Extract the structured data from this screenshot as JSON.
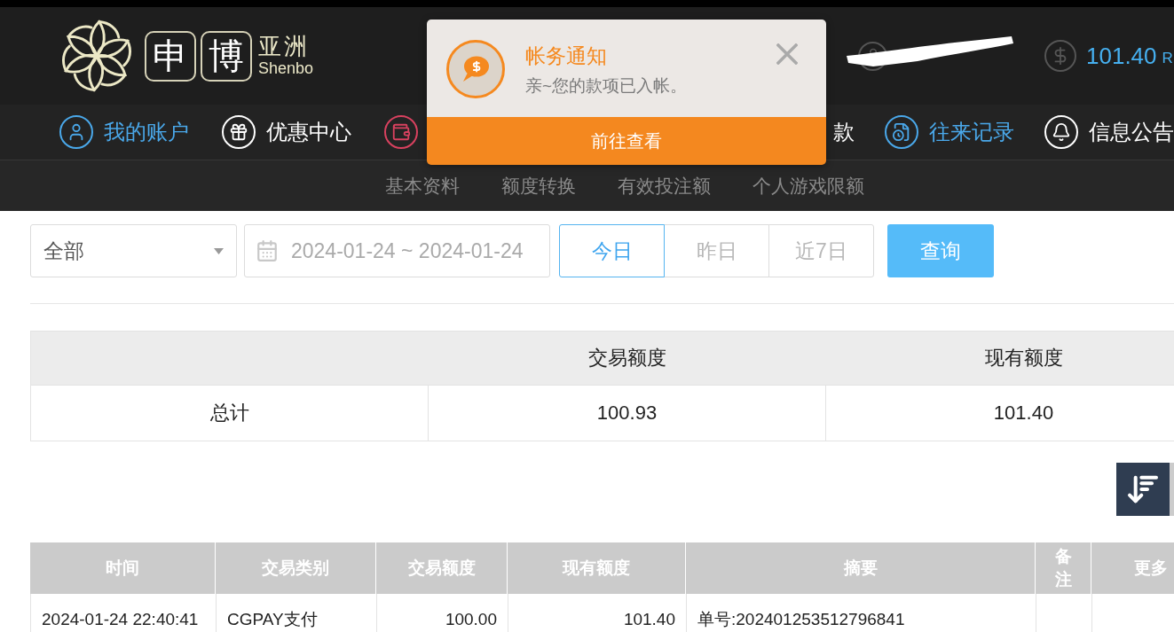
{
  "header": {
    "logo": {
      "characters": [
        "申",
        "博"
      ],
      "name": "亚洲",
      "latin_name": "Shenbo"
    },
    "balance": {
      "amount": "101.40",
      "currency": "R"
    }
  },
  "notification": {
    "title": "帐务通知",
    "message": "亲~您的款项已入帐。",
    "action": "前往查看"
  },
  "nav": {
    "left_items": [
      {
        "kind": "icon_text",
        "label": "我的账户",
        "color": "#4aa8ea"
      },
      {
        "kind": "icon_text",
        "label": "优惠中心",
        "color": "#ffffff"
      },
      {
        "kind": "icon",
        "color": "#d8415f"
      }
    ],
    "right_items": [
      {
        "kind": "text",
        "label": "款",
        "color": "#ffffff"
      },
      {
        "kind": "icon_text",
        "label": "往来记录",
        "color": "#4aa8ea"
      },
      {
        "kind": "icon_text",
        "label": "信息公告",
        "color": "#ffffff"
      }
    ]
  },
  "subnav": {
    "items": [
      "基本资料",
      "额度转换",
      "有效投注额",
      "个人游戏限额"
    ]
  },
  "filters": {
    "type_select": {
      "value": "全部"
    },
    "date_range": {
      "value": "2024-01-24 ~ 2024-01-24"
    },
    "quick_ranges": [
      {
        "label": "今日",
        "selected": true
      },
      {
        "label": "昨日",
        "selected": false
      },
      {
        "label": "近7日",
        "selected": false
      }
    ],
    "query_button": "查询"
  },
  "summary_table": {
    "columns": [
      "交易额度",
      "现有额度"
    ],
    "rows": [
      {
        "label": "总计",
        "cells": [
          "100.93",
          "101.40"
        ]
      }
    ]
  },
  "records_table": {
    "columns": [
      "时间",
      "交易类别",
      "交易额度",
      "现有额度",
      "摘要",
      "备注",
      "更多"
    ],
    "rows": [
      [
        "2024-01-24 22:40:41",
        "CGPAY支付",
        "100.00",
        "101.40",
        "单号:202401253512796841"
      ]
    ]
  }
}
